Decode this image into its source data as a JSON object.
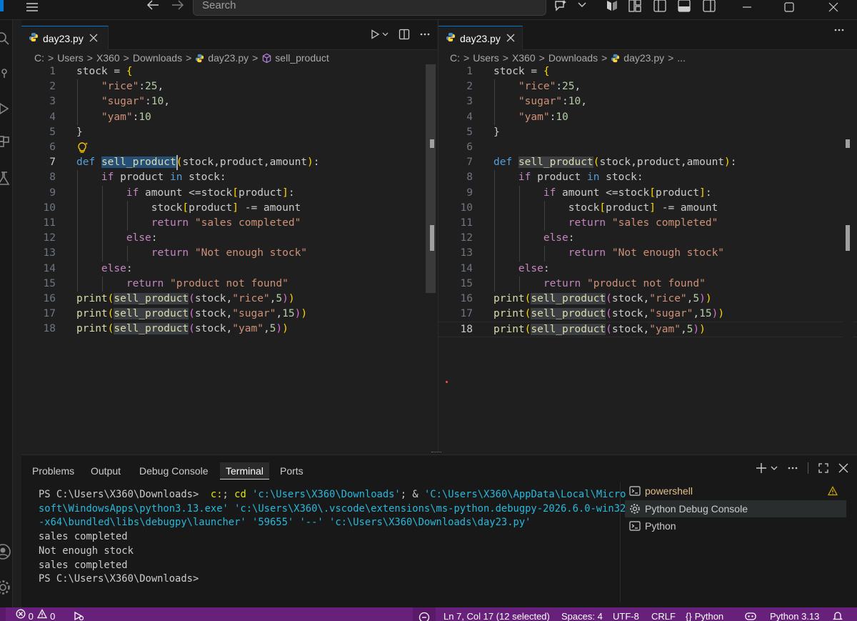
{
  "titlebar": {
    "search_placeholder": "Search",
    "icons": [
      "menu-icon",
      "arrow-left-icon",
      "arrow-right-icon",
      "copilot-icon",
      "chevron-down-icon",
      "layout-icon",
      "toggle-sidebar-icon",
      "toggle-panel-icon",
      "toggle-secondary-sidebar-icon",
      "minimize-icon",
      "maximize-icon",
      "close-icon"
    ]
  },
  "editor_left": {
    "tab": {
      "label": "day23.py"
    },
    "breadcrumb": [
      "C:",
      "Users",
      "X360",
      "Downloads",
      "day23.py",
      "sell_product"
    ]
  },
  "editor_right": {
    "tab": {
      "label": "day23.py"
    },
    "breadcrumb": [
      "C:",
      "Users",
      "X360",
      "Downloads",
      "day23.py",
      "..."
    ]
  },
  "code": {
    "line_numbers": [
      "1",
      "2",
      "3",
      "4",
      "5",
      "6",
      "7",
      "8",
      "9",
      "10",
      "11",
      "12",
      "13",
      "14",
      "15",
      "16",
      "17",
      "18"
    ],
    "lines": [
      "stock = {",
      "    \"rice\":25,",
      "    \"sugar\":10,",
      "    \"yam\":10",
      "}",
      "",
      "def sell_product(stock,product,amount):",
      "    if product in stock:",
      "        if amount <=stock[product]:",
      "            stock[product] -= amount",
      "            return \"sales completed\"",
      "        else:",
      "            return \"Not enough stock\"",
      "    else:",
      "        return \"product not found\"",
      "print(sell_product(stock,\"rice\",5))",
      "print(sell_product(stock,\"sugar\",15))",
      "print(sell_product(stock,\"yam\",5))"
    ]
  },
  "panel": {
    "tabs": [
      "Problems",
      "Output",
      "Debug Console",
      "Terminal",
      "Ports"
    ],
    "active_tab": "Terminal",
    "terminal_lines": [
      {
        "parts": [
          {
            "t": "PS C:\\Users\\X360\\Downloads> ",
            "c": ""
          },
          {
            "t": " c:",
            "c": "t-yellow"
          },
          {
            "t": "; ",
            "c": ""
          },
          {
            "t": "cd",
            "c": "t-yellow"
          },
          {
            "t": " 'c:\\Users\\X360\\Downloads'",
            "c": "t-cyan"
          },
          {
            "t": "; & ",
            "c": ""
          },
          {
            "t": "'C:\\Users\\X360\\AppData\\Local\\Micro",
            "c": "t-cyan"
          }
        ]
      },
      {
        "parts": [
          {
            "t": "soft\\WindowsApps\\python3.13.exe' 'c:\\Users\\X360\\.vscode\\extensions\\ms-python.debugpy-2026.6.0-win32",
            "c": "t-cyan"
          }
        ]
      },
      {
        "parts": [
          {
            "t": "-x64\\bundled\\libs\\debugpy\\launcher' '59655' '--' 'c:\\Users\\X360\\Downloads\\day23.py'",
            "c": "t-cyan"
          }
        ]
      },
      {
        "parts": [
          {
            "t": "sales completed",
            "c": ""
          }
        ]
      },
      {
        "parts": [
          {
            "t": "Not enough stock",
            "c": ""
          }
        ]
      },
      {
        "parts": [
          {
            "t": "sales completed",
            "c": ""
          }
        ]
      },
      {
        "parts": [
          {
            "t": "PS C:\\Users\\X360\\Downloads>",
            "c": ""
          }
        ]
      }
    ],
    "terminals": [
      {
        "label": "powershell",
        "selected": false,
        "icon": "terminal-icon",
        "warning": true
      },
      {
        "label": "Python Debug Console",
        "selected": true,
        "icon": "debug-gear-icon",
        "warning": false
      },
      {
        "label": "Python",
        "selected": false,
        "icon": "terminal-icon",
        "warning": false
      }
    ]
  },
  "statusbar": {
    "errors": "0",
    "warnings": "0",
    "cursor": "Ln 7, Col 17 (12 selected)",
    "spaces": "Spaces: 4",
    "encoding": "UTF-8",
    "eol": "CRLF",
    "language": "Python",
    "interpreter": "Python 3.13"
  },
  "colors": {
    "statusbar": "#68217a",
    "accent": "#0078d4",
    "editor_bg": "#1f1f1f"
  }
}
